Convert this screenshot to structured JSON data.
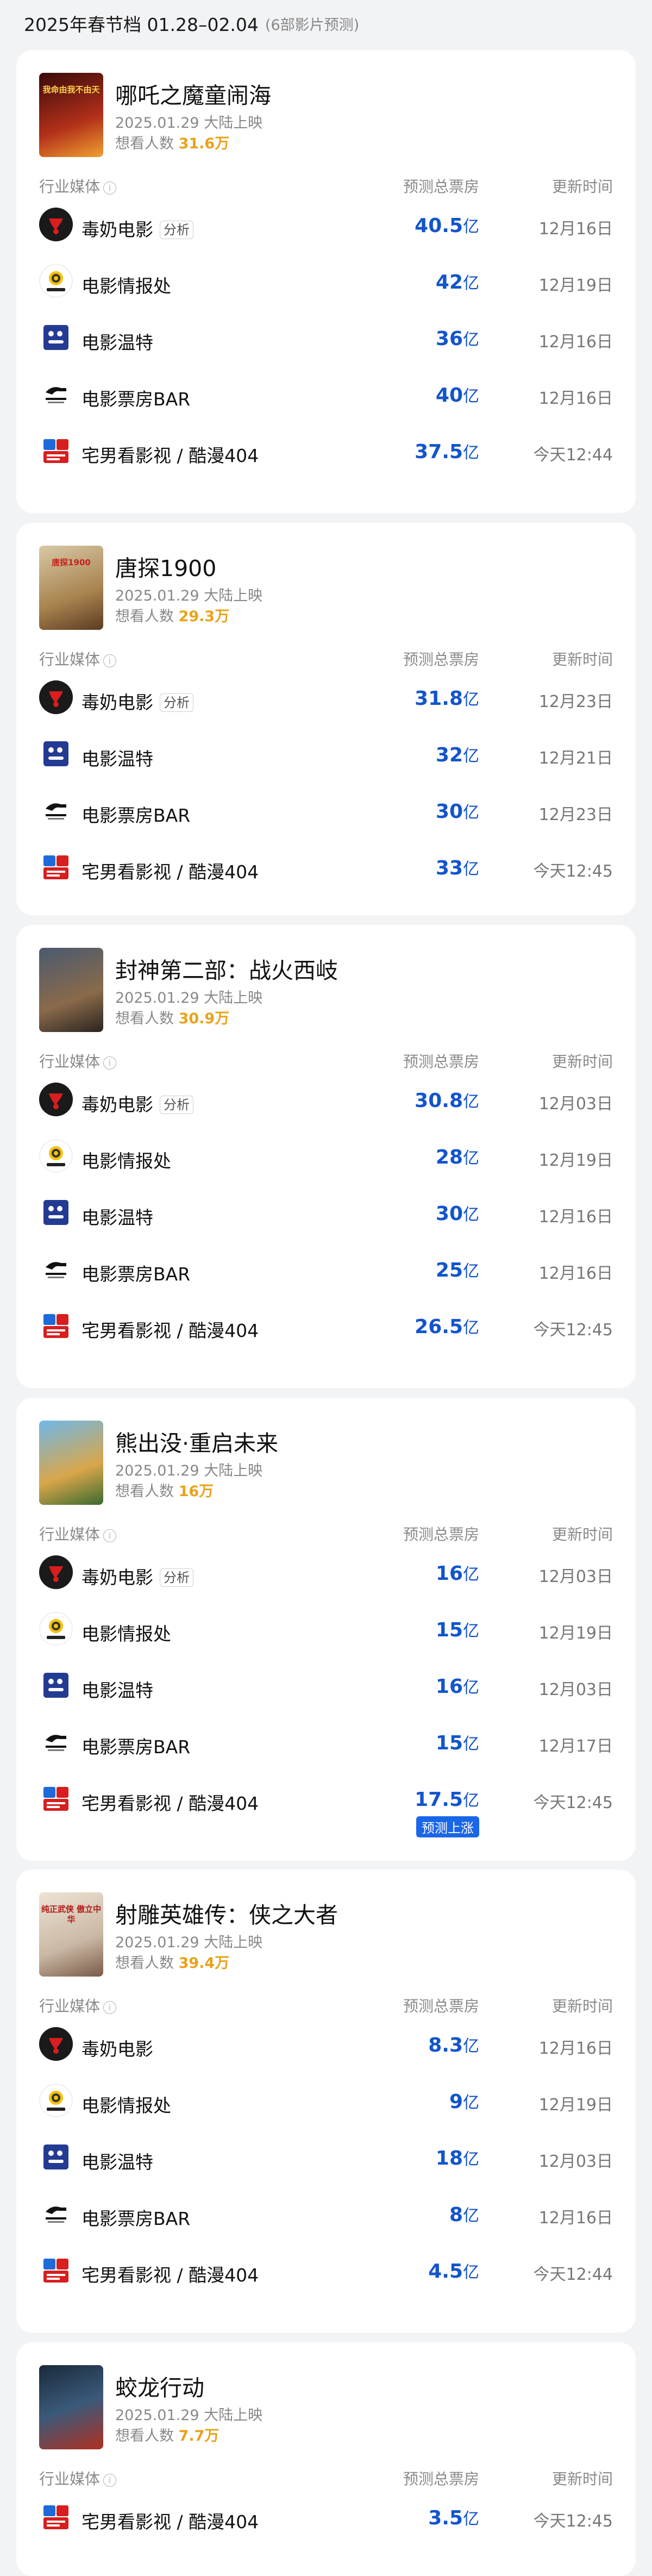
{
  "header": {
    "title": "2025年春节档 01.28–02.04",
    "subtitle": "(6部影片预测)"
  },
  "labels": {
    "col_media": "行业媒体",
    "col_box": "预测总票房",
    "col_time": "更新时间",
    "want_prefix": "想看人数",
    "unit": "亿",
    "analysis_tag": "分析"
  },
  "movies": [
    {
      "title": "哪吒之魔童闹海",
      "release": "2025.01.29 大陆上映",
      "want": "31.6万",
      "poster_text": "我命由我不由天",
      "rows": [
        {
          "media": "毒奶电影",
          "logo": "duonai",
          "tag": "分析",
          "value": "40.5",
          "unit": "亿",
          "time": "12月16日"
        },
        {
          "media": "电影情报处",
          "logo": "qingbao",
          "value": "42",
          "unit": "亿",
          "time": "12月19日"
        },
        {
          "media": "电影温特",
          "logo": "wente",
          "value": "36",
          "unit": "亿",
          "time": "12月16日"
        },
        {
          "media": "电影票房BAR",
          "logo": "bar",
          "value": "40",
          "unit": "亿",
          "time": "12月16日"
        },
        {
          "media": "宅男看影视 / 酷漫404",
          "logo": "zhai",
          "value": "37.5",
          "unit": "亿",
          "time": "今天12:44"
        }
      ]
    },
    {
      "title": "唐探1900",
      "release": "2025.01.29 大陆上映",
      "want": "29.3万",
      "poster_text": "唐探1900",
      "rows": [
        {
          "media": "毒奶电影",
          "logo": "duonai",
          "tag": "分析",
          "value": "31.8",
          "unit": "亿",
          "time": "12月23日"
        },
        {
          "media": "电影温特",
          "logo": "wente",
          "value": "32",
          "unit": "亿",
          "time": "12月21日"
        },
        {
          "media": "电影票房BAR",
          "logo": "bar",
          "value": "30",
          "unit": "亿",
          "time": "12月23日"
        },
        {
          "media": "宅男看影视 / 酷漫404",
          "logo": "zhai",
          "value": "33",
          "unit": "亿",
          "time": "今天12:45"
        }
      ]
    },
    {
      "title": "封神第二部：战火西岐",
      "release": "2025.01.29 大陆上映",
      "want": "30.9万",
      "poster_text": "",
      "rows": [
        {
          "media": "毒奶电影",
          "logo": "duonai",
          "tag": "分析",
          "value": "30.8",
          "unit": "亿",
          "time": "12月03日"
        },
        {
          "media": "电影情报处",
          "logo": "qingbao",
          "value": "28",
          "unit": "亿",
          "time": "12月19日"
        },
        {
          "media": "电影温特",
          "logo": "wente",
          "value": "30",
          "unit": "亿",
          "time": "12月16日"
        },
        {
          "media": "电影票房BAR",
          "logo": "bar",
          "value": "25",
          "unit": "亿",
          "time": "12月16日"
        },
        {
          "media": "宅男看影视 / 酷漫404",
          "logo": "zhai",
          "value": "26.5",
          "unit": "亿",
          "time": "今天12:45"
        }
      ]
    },
    {
      "title": "熊出没·重启未来",
      "release": "2025.01.29 大陆上映",
      "want": "16万",
      "poster_text": "",
      "rows": [
        {
          "media": "毒奶电影",
          "logo": "duonai",
          "tag": "分析",
          "value": "16",
          "unit": "亿",
          "time": "12月03日"
        },
        {
          "media": "电影情报处",
          "logo": "qingbao",
          "value": "15",
          "unit": "亿",
          "time": "12月19日"
        },
        {
          "media": "电影温特",
          "logo": "wente",
          "value": "16",
          "unit": "亿",
          "time": "12月03日"
        },
        {
          "media": "电影票房BAR",
          "logo": "bar",
          "value": "15",
          "unit": "亿",
          "time": "12月17日"
        },
        {
          "media": "宅男看影视 / 酷漫404",
          "logo": "zhai",
          "value": "17.5",
          "unit": "亿",
          "time": "今天12:45",
          "badge": "预测上涨"
        }
      ]
    },
    {
      "title": "射雕英雄传：侠之大者",
      "release": "2025.01.29 大陆上映",
      "want": "39.4万",
      "poster_text": "纯正武侠 傲立中华",
      "rows": [
        {
          "media": "毒奶电影",
          "logo": "duonai",
          "value": "8.3",
          "unit": "亿",
          "time": "12月16日"
        },
        {
          "media": "电影情报处",
          "logo": "qingbao",
          "value": "9",
          "unit": "亿",
          "time": "12月19日"
        },
        {
          "media": "电影温特",
          "logo": "wente",
          "value": "18",
          "unit": "亿",
          "time": "12月03日"
        },
        {
          "media": "电影票房BAR",
          "logo": "bar",
          "value": "8",
          "unit": "亿",
          "time": "12月16日"
        },
        {
          "media": "宅男看影视 / 酷漫404",
          "logo": "zhai",
          "value": "4.5",
          "unit": "亿",
          "time": "今天12:44"
        }
      ]
    },
    {
      "title": "蛟龙行动",
      "release": "2025.01.29 大陆上映",
      "want": "7.7万",
      "poster_text": "",
      "rows": [
        {
          "media": "宅男看影视 / 酷漫404",
          "logo": "zhai",
          "value": "3.5",
          "unit": "亿",
          "time": "今天12:45"
        }
      ]
    }
  ]
}
